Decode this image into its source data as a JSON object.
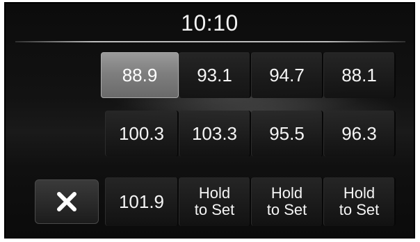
{
  "header": {
    "clock": "10:10"
  },
  "presets": {
    "row1": [
      "88.9",
      "93.1",
      "94.7",
      "88.1"
    ],
    "row2": [
      "100.3",
      "103.3",
      "95.5",
      "96.3"
    ],
    "row3_station": "101.9",
    "hold_line1": "Hold",
    "hold_line2": "to Set"
  },
  "active_preset": "88.9",
  "icons": {
    "close": "close-icon"
  },
  "colors": {
    "background": "#111111",
    "text": "#f5f5f5",
    "active_preset": "#8a8a8a"
  }
}
